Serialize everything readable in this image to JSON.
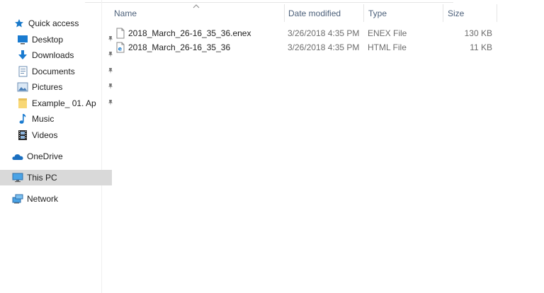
{
  "nav": {
    "quick_access": "Quick access",
    "desktop": "Desktop",
    "downloads": "Downloads",
    "documents": "Documents",
    "pictures": "Pictures",
    "example": "Example_ 01. Ap",
    "music": "Music",
    "videos": "Videos",
    "onedrive": "OneDrive",
    "this_pc": "This PC",
    "network": "Network"
  },
  "columns": {
    "name": "Name",
    "date": "Date modified",
    "type": "Type",
    "size": "Size"
  },
  "files": [
    {
      "name": "2018_March_26-16_35_36.enex",
      "date": "3/26/2018 4:35 PM",
      "type": "ENEX File",
      "size": "130 KB"
    },
    {
      "name": "2018_March_26-16_35_36",
      "date": "3/26/2018 4:35 PM",
      "type": "HTML File",
      "size": "11 KB"
    }
  ],
  "colors": {
    "selected_bg": "#d9d9d9",
    "header_text": "#4c607a",
    "accent": "#1979ca"
  }
}
